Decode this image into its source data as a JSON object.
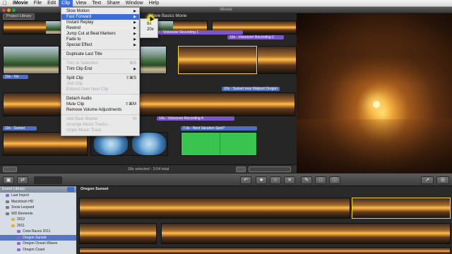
{
  "menubar": {
    "app": "iMovie",
    "items": [
      "File",
      "Edit",
      "Clip",
      "View",
      "Text",
      "Share",
      "Window",
      "Help"
    ],
    "active": "Clip"
  },
  "window": {
    "title": "iMovie"
  },
  "project": {
    "library_button": "Project Library",
    "title": "iMovie Basics Movie",
    "status": "18s selected - 3:04 total",
    "tags": [
      "4.4s - Voiceover Recording 1",
      "10s - Voiceover Recording 2",
      "10s - Voi",
      "10s - Sunset near Walport Oregon",
      "14s - Voiceover Recording 4",
      "10s - Sunset",
      "7.9s - Next Vacation Spot?"
    ]
  },
  "clip_menu": {
    "groups": [
      [
        {
          "label": "Slow Motion",
          "submenu": true
        },
        {
          "label": "Fast Forward",
          "submenu": true,
          "highlighted": true
        },
        {
          "label": "Instant Replay",
          "submenu": true
        },
        {
          "label": "Rewind",
          "submenu": true
        },
        {
          "label": "Jump Cut at Beat Markers",
          "submenu": true
        },
        {
          "label": "Fade to",
          "submenu": true
        },
        {
          "label": "Special Effect",
          "submenu": true
        }
      ],
      [
        {
          "label": "Duplicate Last Title"
        }
      ],
      [
        {
          "label": "Trim to Selection",
          "shortcut": "⌘B",
          "disabled": true
        },
        {
          "label": "Trim Clip End",
          "submenu": true
        }
      ],
      [
        {
          "label": "Split Clip",
          "shortcut": "⇧⌘S"
        },
        {
          "label": "Join Clip",
          "disabled": true
        },
        {
          "label": "Extend Over Next Clip",
          "disabled": true
        }
      ],
      [
        {
          "label": "Detach Audio"
        },
        {
          "label": "Mute Clip",
          "shortcut": "⇧⌘M"
        },
        {
          "label": "Remove Volume Adjustments"
        }
      ],
      [
        {
          "label": "Add Beat Marker",
          "shortcut": "M",
          "disabled": true
        },
        {
          "label": "Arrange Music Tracks...",
          "disabled": true
        },
        {
          "label": "Unpin Music Track",
          "disabled": true
        }
      ]
    ]
  },
  "submenu": {
    "items": [
      "8x",
      "20x"
    ]
  },
  "event_library": {
    "title": "Event Library",
    "items": [
      {
        "label": "Last Import",
        "indent": 1,
        "icon": "film-icon"
      },
      {
        "label": "Macintosh HD",
        "indent": 1,
        "icon": "drive-icon"
      },
      {
        "label": "Snow Leopard",
        "indent": 1,
        "icon": "drive-icon"
      },
      {
        "label": "WD Elements",
        "indent": 1,
        "icon": "drive-icon"
      },
      {
        "label": "2012",
        "indent": 2,
        "icon": "folder-icon"
      },
      {
        "label": "2011",
        "indent": 2,
        "icon": "folder-icon"
      },
      {
        "label": "Crew Races 2011",
        "indent": 3,
        "icon": "film-icon"
      },
      {
        "label": "Oregon Sunset",
        "indent": 3,
        "icon": "film-icon",
        "selected": true
      },
      {
        "label": "Oregon Ocean Waves",
        "indent": 3,
        "icon": "film-icon"
      },
      {
        "label": "Oregon Coast",
        "indent": 3,
        "icon": "film-icon"
      }
    ]
  },
  "event_browser": {
    "title": "Oregon Sunset"
  },
  "toolbar": {
    "buttons": [
      "camera-icon",
      "swap-icon",
      "undo-icon",
      "favorite-icon",
      "unmark-icon",
      "reject-icon",
      "keyword-icon",
      "crop-icon",
      "adjust-icon"
    ]
  },
  "colors": {
    "menu_highlight": "#3b6fd8",
    "selection": "#f3d23a",
    "voiceover_tag": "#7c55c6",
    "title_tag": "#4e6fc0",
    "green_clip": "#39c450"
  }
}
